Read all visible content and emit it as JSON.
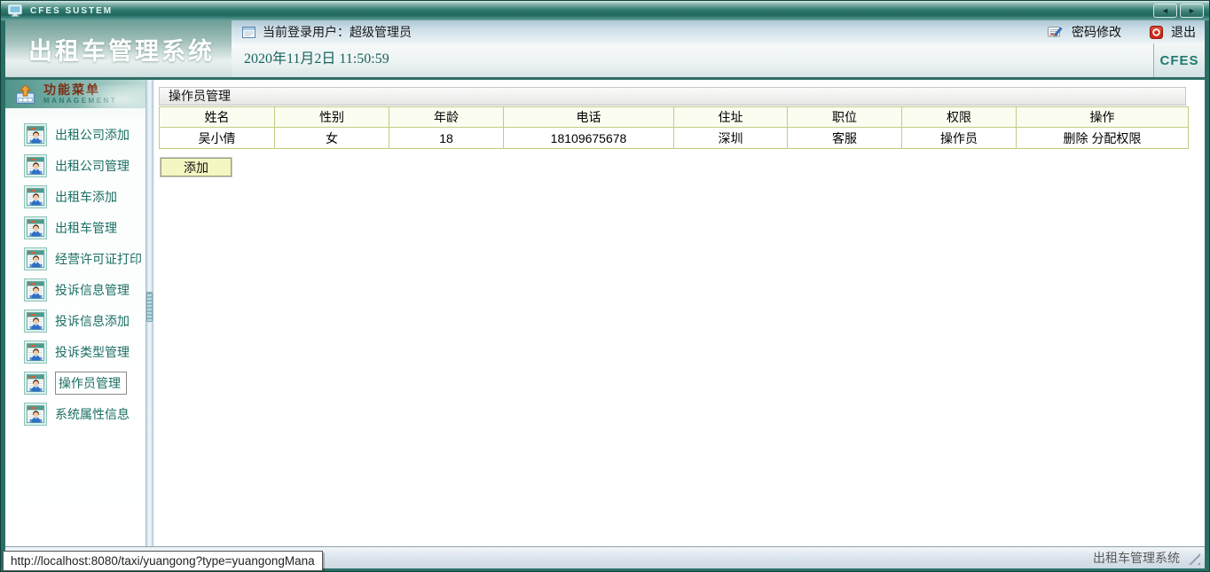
{
  "window": {
    "title": "CFES SUSTEM",
    "nav_back": "◄",
    "nav_forward": "►"
  },
  "header": {
    "app_title": "出租车管理系统",
    "login_label": "当前登录用户：超级管理员",
    "datetime": "2020年11月2日 11:50:59",
    "password_change_label": "密码修改",
    "logout_label": "退出",
    "brand": "CFES"
  },
  "sidebar": {
    "title": "功能菜单",
    "subtitle": "MANAGEMENT",
    "items": [
      {
        "label": "出租公司添加",
        "selected": false
      },
      {
        "label": "出租公司管理",
        "selected": false
      },
      {
        "label": "出租车添加",
        "selected": false
      },
      {
        "label": "出租车管理",
        "selected": false
      },
      {
        "label": "经营许可证打印",
        "selected": false
      },
      {
        "label": "投诉信息管理",
        "selected": false
      },
      {
        "label": "投诉信息添加",
        "selected": false
      },
      {
        "label": "投诉类型管理",
        "selected": false
      },
      {
        "label": "操作员管理",
        "selected": true
      },
      {
        "label": "系统属性信息",
        "selected": false
      }
    ]
  },
  "main": {
    "panel_title": "操作员管理",
    "table": {
      "columns": [
        "姓名",
        "性别",
        "年龄",
        "电话",
        "住址",
        "职位",
        "权限",
        "操作"
      ],
      "rows": [
        {
          "cells": [
            "吴小倩",
            "女",
            "18",
            "18109675678",
            "深圳",
            "客服",
            "操作员"
          ],
          "actions": [
            "删除",
            "分配权限"
          ]
        }
      ]
    },
    "add_button_label": "添加"
  },
  "statusbar": {
    "url_tooltip": "http://localhost:8080/taxi/yuangong?type=yuangongMana",
    "right_text": "出租车管理系统"
  },
  "colors": {
    "accent_teal": "#2f7a6f",
    "menu_text": "#1b6e64",
    "table_border": "#c2cc85",
    "table_header_bg": "#fafdf0",
    "button_bg": "#f4f7c2",
    "sidebar_title_text": "#7a2e14",
    "logout_icon_red": "#cc2a1a"
  }
}
